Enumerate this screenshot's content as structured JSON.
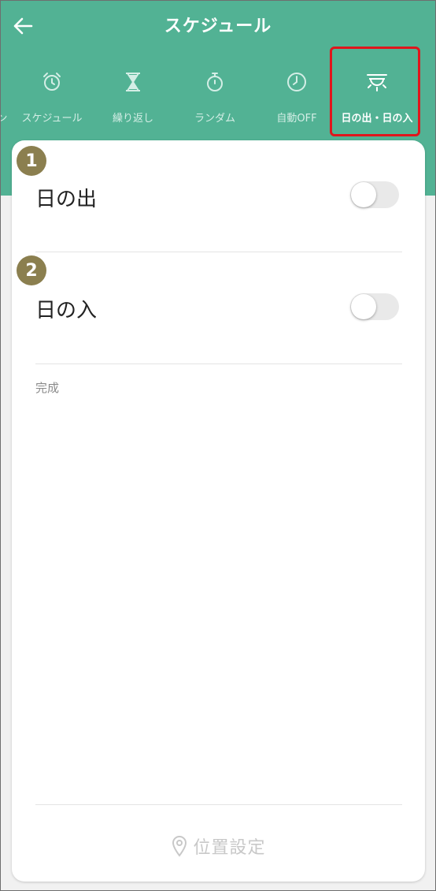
{
  "header": {
    "title": "スケジュール",
    "back_icon": "arrow-left-icon"
  },
  "tabs": [
    {
      "label": "ン",
      "icon": "none",
      "active": false
    },
    {
      "label": "スケジュール",
      "icon": "alarm-clock-icon",
      "active": false
    },
    {
      "label": "繰り返し",
      "icon": "hourglass-icon",
      "active": false
    },
    {
      "label": "ランダム",
      "icon": "stopwatch-icon",
      "active": false
    },
    {
      "label": "自動OFF",
      "icon": "clock-icon",
      "active": false
    },
    {
      "label": "日の出・日の入",
      "icon": "sunrise-icon",
      "active": true
    }
  ],
  "settings": [
    {
      "badge": "1",
      "label": "日の出",
      "enabled": false
    },
    {
      "badge": "2",
      "label": "日の入",
      "enabled": false
    }
  ],
  "done_label": "完成",
  "location_button": {
    "label": "位置設定",
    "icon": "location-pin-icon"
  },
  "colors": {
    "header_green": "#52b294",
    "highlight_red": "#e0161c",
    "badge_olive": "#8b7f4f"
  }
}
